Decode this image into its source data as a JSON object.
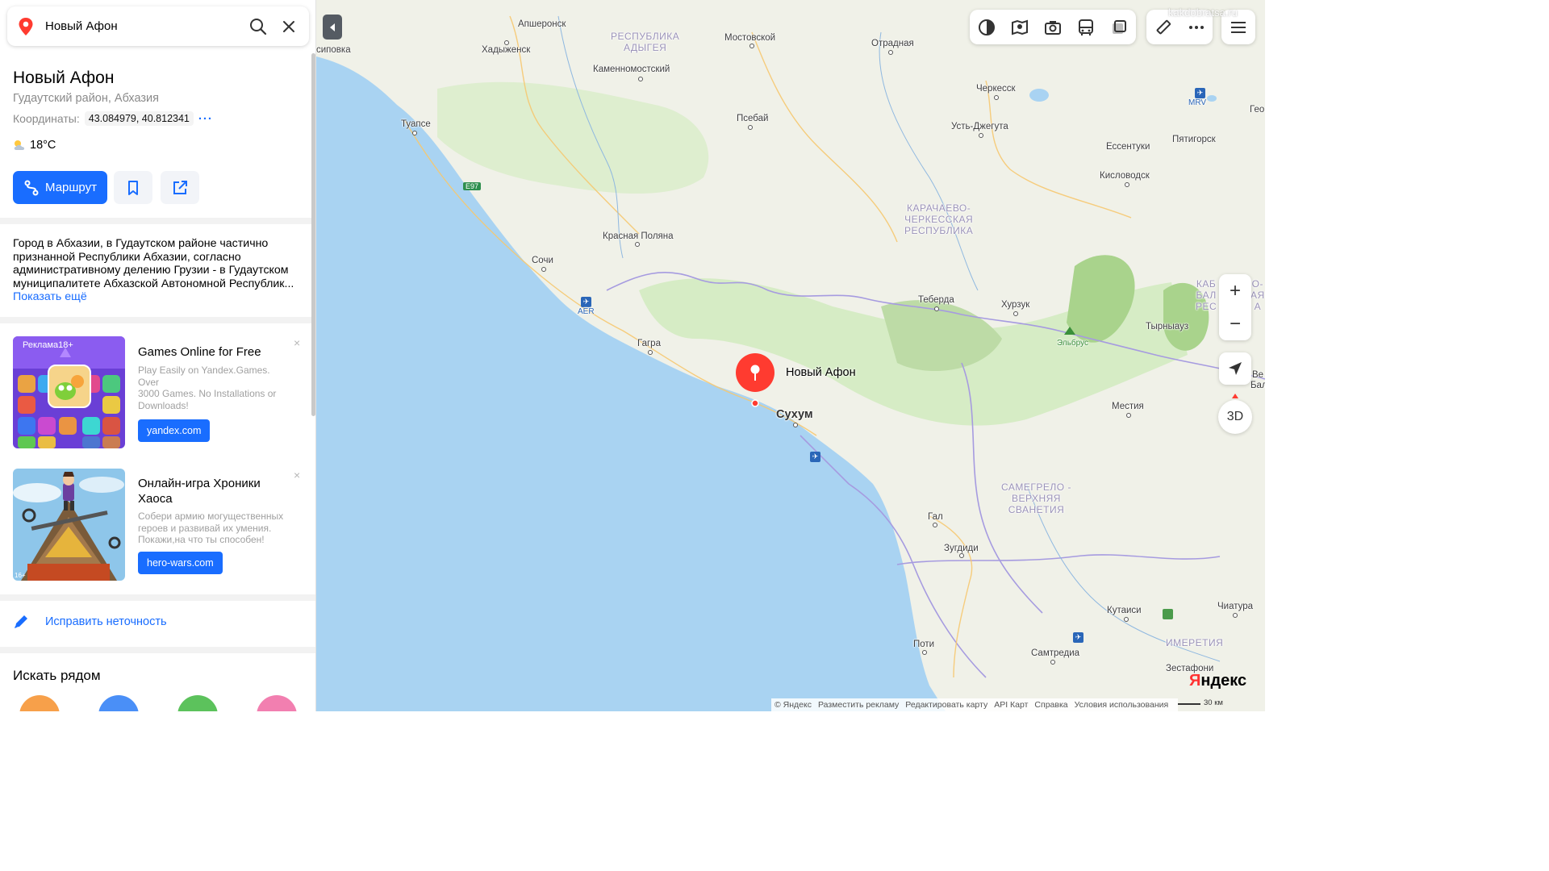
{
  "search": {
    "query": "Новый Афон"
  },
  "place": {
    "title": "Новый Афон",
    "subtitle": "Гудаутский район, Абхазия",
    "coords_label": "Координаты:",
    "coords_value": "43.084979, 40.812341",
    "more": "···",
    "temperature": "18°C"
  },
  "actions": {
    "route_label": "Маршрут"
  },
  "description": {
    "lines": [
      "Город в Абхазии, в Гудаутском районе частично",
      "признанной Республики Абхазии, согласно",
      "административному делению Грузии - в Гудаутском",
      "муниципалитете Абхазской Автономной Республик..."
    ],
    "show_more": "Показать ещё"
  },
  "ads": [
    {
      "label": "Реклама18+",
      "title": "Games Online for Free",
      "text_lines": [
        "Play Easily on Yandex.Games. Over",
        "3000 Games. No Installations or",
        "Downloads!"
      ],
      "button": "yandex.com",
      "close": "×"
    },
    {
      "title": "Онлайн-игра Хроники Хаоса",
      "text_lines": [
        "Собери армию могущественных",
        "героев и развивай их умения.",
        "Покажи,на что ты способен!"
      ],
      "button": "hero-wars.com",
      "close": "×",
      "age": "16+"
    }
  ],
  "fix_label": "Исправить неточность",
  "nearby_title": "Искать рядом",
  "map": {
    "places": {
      "apsheronsk": "Апшеронск",
      "khadyzhensk": "Хадыженск",
      "sipovka": "сиповка",
      "mostovskoy": "Мостовской",
      "otradnaya": "Отрадная",
      "kamennomostsky": "Каменномостский",
      "cherkessk": "Черкесск",
      "tuapse": "Туапсе",
      "psebay": "Псебай",
      "ust_dzheguta": "Усть-Джегута",
      "essentuki": "Ессентуки",
      "pyatigorsk": "Пятигорск",
      "kislovodsk": "Кисловодск",
      "krasnaya_polyana": "Красная Поляна",
      "sochi": "Сочи",
      "teberda": "Теберда",
      "khurzuk": "Хурзук",
      "tyrnyauz": "Тырныауз",
      "elbrus": "Эльбрус",
      "gagra": "Гагра",
      "sukhum": "Сухум",
      "mestia": "Местия",
      "gal": "Гал",
      "zugdidi": "Зугдиди",
      "kutaisi": "Кутаиси",
      "chiatura": "Чиатура",
      "poti": "Поти",
      "samtredia": "Самтредиа",
      "zestafoni": "Зестафони",
      "geo_edge": "Гео",
      "ve_edge": "Be",
      "bal_edge": "Бал"
    },
    "regions": {
      "adygea": "РЕСПУБЛИКА\nАДЫГЕЯ",
      "kchr": "КАРАЧАЕВО-\nЧЕРКЕССКАЯ\nРЕСПУБЛИКА",
      "samegrelo": "САМЕГРЕЛО -\nВЕРХНЯЯ\nСВАНЕТИЯ",
      "imereti": "ИМЕРЕТИЯ",
      "kbr_edge": "КАБ\nБАЛ\nРЕС",
      "kbr_edge2": "О-\nАЯ\nА"
    },
    "tags": {
      "e97": "E97",
      "aer": "AER",
      "mrv": "MRV"
    },
    "marker_label": "Новый Афон",
    "zoom_in": "+",
    "zoom_out": "−",
    "btn_3d": "3D",
    "footer": [
      "© Яндекс",
      "Разместить рекламу",
      "Редактировать карту",
      "API Карт",
      "Справка",
      "Условия использования"
    ],
    "brand_first": "Я",
    "brand_rest": "ндекс",
    "scale": "30 км",
    "watermark": "kakdobratsa.ru"
  },
  "colors": {
    "accent": "#196dff",
    "sea": "#a9d3f2",
    "land": "#f0f1e8",
    "forest": "#c7e3b3",
    "marker": "#ff3b30"
  }
}
